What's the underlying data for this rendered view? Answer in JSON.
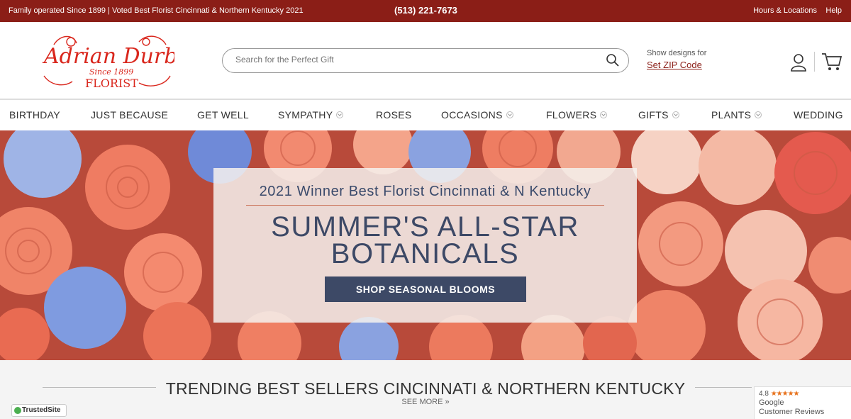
{
  "topbar": {
    "tagline": "Family operated Since 1899 | Voted Best Florist Cincinnati & Northern Kentucky 2021",
    "phone": "(513) 221-7673",
    "hours": "Hours & Locations",
    "help": "Help"
  },
  "logo": {
    "line1": "Adrian Durban",
    "line2": "Since 1899",
    "line3": "FLORIST"
  },
  "search": {
    "placeholder": "Search for the Perfect Gift"
  },
  "zip": {
    "label": "Show designs for",
    "link": "Set ZIP Code"
  },
  "nav": {
    "items": [
      {
        "label": "BIRTHDAY"
      },
      {
        "label": "JUST BECAUSE"
      },
      {
        "label": "GET WELL"
      },
      {
        "label": "SYMPATHY"
      },
      {
        "label": "ROSES"
      },
      {
        "label": "OCCASIONS"
      },
      {
        "label": "FLOWERS"
      },
      {
        "label": "GIFTS"
      },
      {
        "label": "PLANTS"
      },
      {
        "label": "WEDDING"
      }
    ]
  },
  "hero": {
    "winner": "2021 Winner Best Florist Cincinnati & N Kentucky",
    "headline_1": "SUMMER'S ALL-STAR",
    "headline_2": "BOTANICALS",
    "cta": "SHOP SEASONAL BLOOMS"
  },
  "trending": {
    "title": "TRENDING BEST SELLERS CINCINNATI & NORTHERN KENTUCKY",
    "more": "SEE MORE »"
  },
  "badges": {
    "trusted": "TrustedSite",
    "google_rating": "4.8",
    "google_stars": "★★★★★",
    "google_name": "Google",
    "google_sub": "Customer Reviews"
  },
  "colors": {
    "brand_red": "#8b1e17",
    "navy": "#3d4966",
    "coral": "#e9735a"
  }
}
